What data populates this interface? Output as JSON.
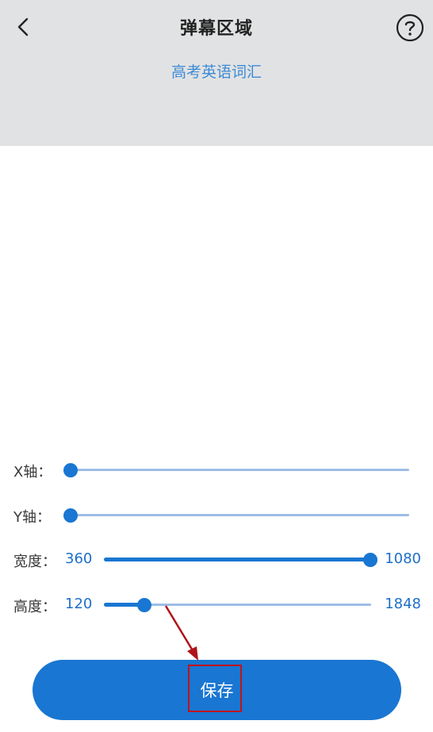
{
  "header": {
    "title": "弹幕区域",
    "sample_text": "高考英语词汇",
    "background_color": "#e1e2e3",
    "back_icon": "chevron-left-icon",
    "help_icon": "question-circle-icon"
  },
  "sliders": {
    "x": {
      "label": "X轴：",
      "min_label": "",
      "max_label": "",
      "value_fraction": 0.0
    },
    "y": {
      "label": "Y轴：",
      "min_label": "",
      "max_label": "",
      "value_fraction": 0.0
    },
    "width": {
      "label": "宽度：",
      "min_label": "360",
      "max_label": "1080",
      "value_fraction": 1.0
    },
    "height": {
      "label": "高度：",
      "min_label": "120",
      "max_label": "1848",
      "value_fraction": 0.15
    }
  },
  "save_button": {
    "label": "保存"
  },
  "colors": {
    "accent": "#1976d2",
    "track": "#9dbde6",
    "sample_text": "#3d8bd7",
    "annotation": "#c0141a"
  }
}
